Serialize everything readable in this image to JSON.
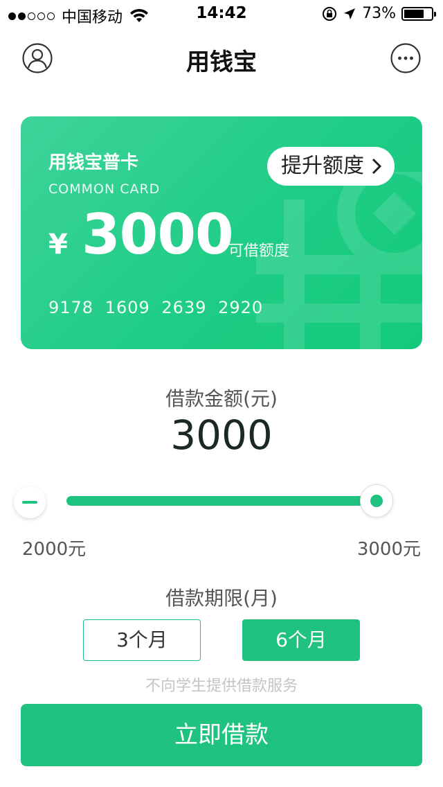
{
  "status_bar": {
    "carrier": "中国移动",
    "time": "14:42",
    "battery": "73%",
    "battery_level": 0.73,
    "icons": [
      "signal-dots-icon",
      "wifi-icon",
      "rotation-lock-icon",
      "location-arrow-icon",
      "battery-icon"
    ]
  },
  "nav": {
    "title": "用钱宝",
    "left_icon": "user-avatar-icon",
    "right_icon": "more-icon"
  },
  "card": {
    "title": "用钱宝普卡",
    "subtitle": "COMMON CARD",
    "currency": "¥",
    "amount": "3000",
    "amount_label": "可借额度",
    "number": "9178 1609 2639 2920",
    "raise_button": "提升额度",
    "colors": {
      "start": "#3ed39a",
      "end": "#14c97c"
    }
  },
  "loan": {
    "label": "借款金额(元)",
    "value": "3000",
    "slider_level": 1.0,
    "min_label": "2000元",
    "max_label": "3000元"
  },
  "term": {
    "label": "借款期限(月)",
    "options": [
      "3个月",
      "6个月"
    ],
    "selected": "6个月"
  },
  "notice": "不向学生提供借款服务",
  "submit_label": "立即借款",
  "accent_color": "#1fc27f"
}
